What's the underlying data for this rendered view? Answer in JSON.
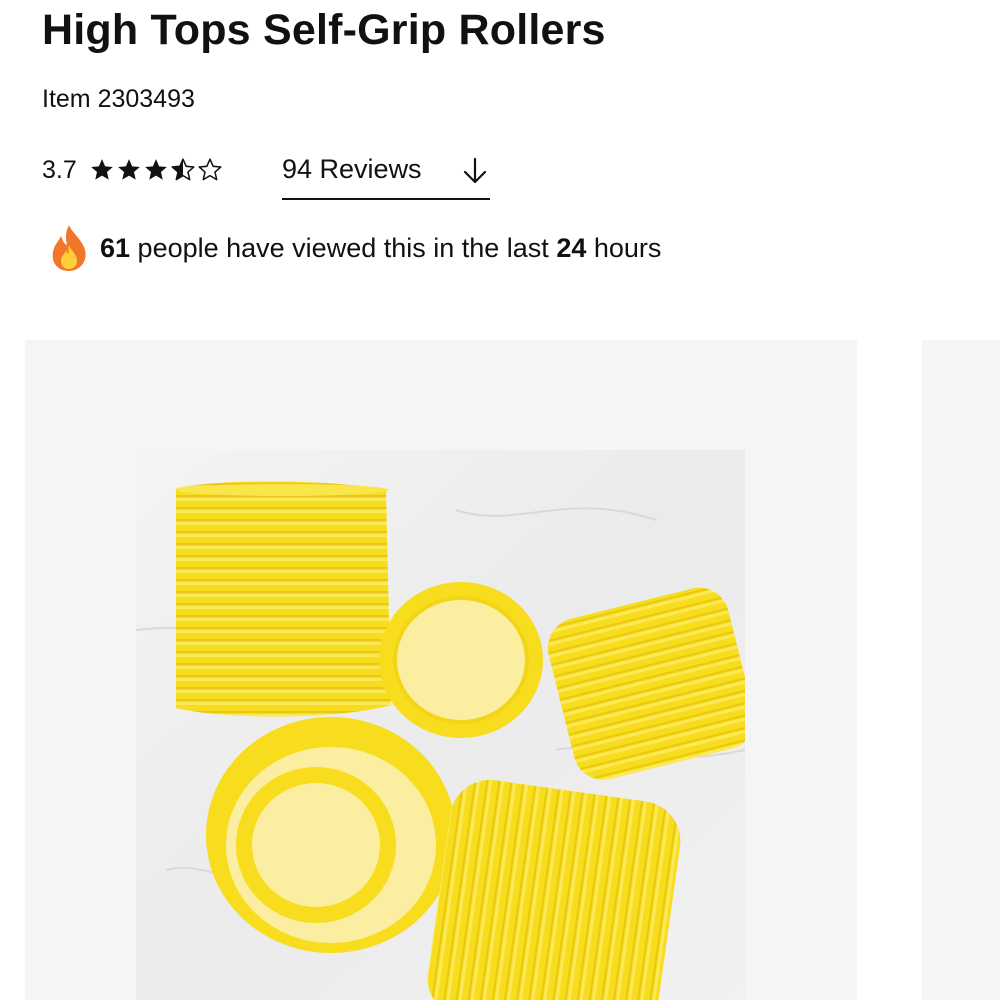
{
  "product": {
    "title": "High Tops Self-Grip Rollers",
    "item_number": "Item 2303493"
  },
  "rating": {
    "value": "3.7",
    "score": 3.7,
    "max": 5,
    "reviews_label": "94 Reviews"
  },
  "social_proof": {
    "icon": "fire-icon",
    "count": "61",
    "text_middle": " people have viewed this in the last ",
    "hours": "24",
    "text_end": " hours"
  },
  "gallery": {
    "image_alt": "yellow self-grip hair rollers",
    "roller_color": "#f7dd1e"
  },
  "colors": {
    "panel_bg": "#f5f5f5",
    "text": "#111111",
    "fire_outer": "#f2762a",
    "fire_inner": "#ffcf3a"
  }
}
